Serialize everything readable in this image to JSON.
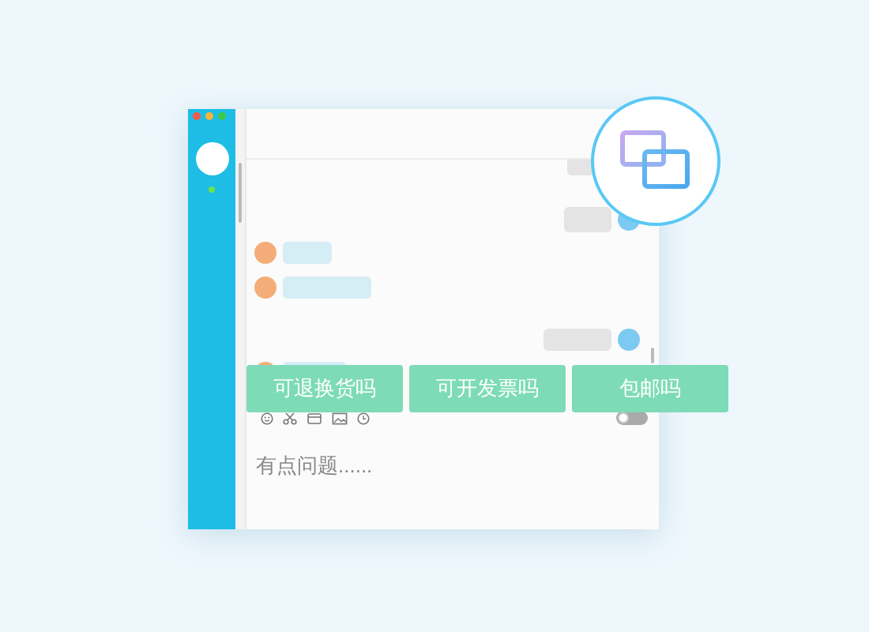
{
  "messages": [
    {
      "kind": "outgoing",
      "avatar": false
    },
    {
      "kind": "outgoing",
      "avatar": true
    },
    {
      "kind": "incoming",
      "avatar": true
    },
    {
      "kind": "incoming",
      "avatar": true
    },
    {
      "kind": "outgoing",
      "avatar": true
    },
    {
      "kind": "incoming",
      "avatar": true
    }
  ],
  "quick_replies": [
    {
      "label": "可退换货吗"
    },
    {
      "label": "可开发票吗"
    },
    {
      "label": "包邮吗"
    }
  ],
  "toggle": {
    "on": false
  },
  "input": {
    "value": "有点问题......"
  }
}
